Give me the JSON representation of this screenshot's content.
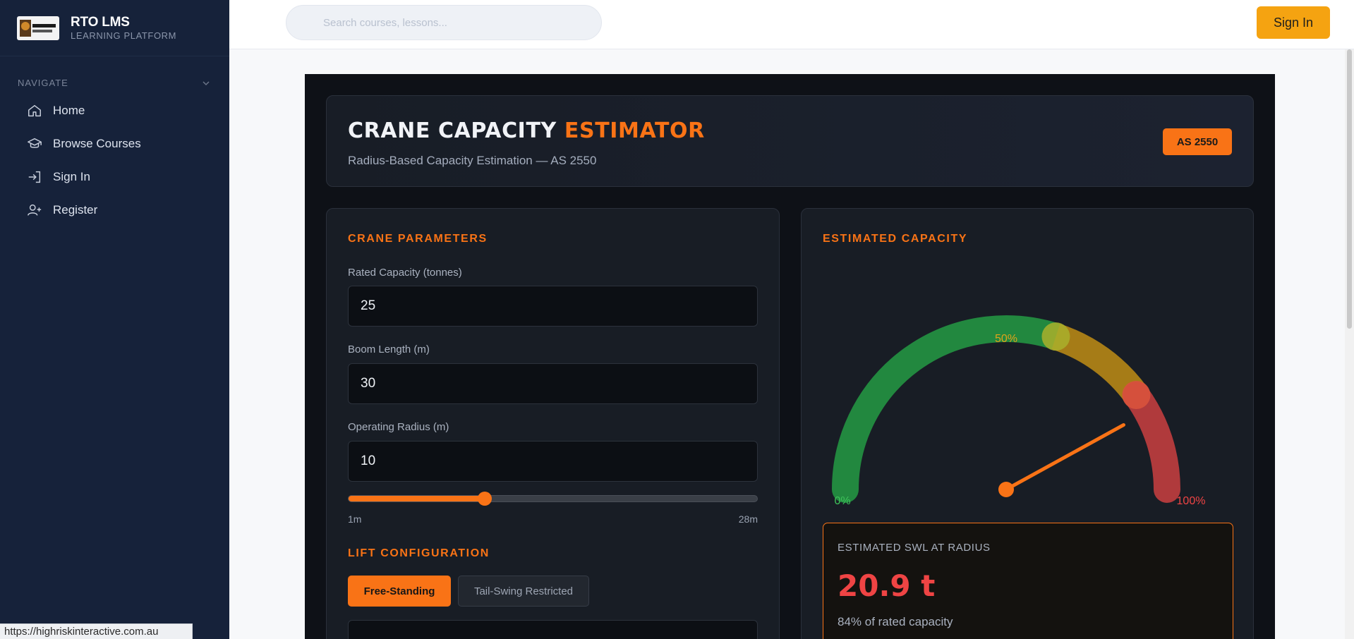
{
  "brand": {
    "title": "RTO LMS",
    "subtitle": "LEARNING PLATFORM",
    "logo_text": "HIGH RISK INTERACTIVE"
  },
  "sidebar": {
    "header": "NAVIGATE",
    "items": [
      {
        "label": "Home",
        "icon": "home-icon"
      },
      {
        "label": "Browse Courses",
        "icon": "graduation-cap-icon"
      },
      {
        "label": "Sign In",
        "icon": "sign-in-icon"
      },
      {
        "label": "Register",
        "icon": "user-plus-icon"
      }
    ]
  },
  "topbar": {
    "search_placeholder": "Search courses, lessons...",
    "signin_label": "Sign In"
  },
  "estimator": {
    "title_part1": "CRANE CAPACITY",
    "title_part2": "ESTIMATOR",
    "subtitle": "Radius-Based Capacity Estimation — AS 2550",
    "badge": "AS 2550",
    "accent_color": "#f97316"
  },
  "params": {
    "section_title": "CRANE PARAMETERS",
    "fields": [
      {
        "label": "Rated Capacity (tonnes)",
        "value": "25"
      },
      {
        "label": "Boom Length (m)",
        "value": "30"
      },
      {
        "label": "Operating Radius (m)",
        "value": "10"
      }
    ],
    "slider": {
      "min_label": "1m",
      "max_label": "28m",
      "min": 1,
      "max": 28,
      "value": 10
    },
    "config_title": "LIFT CONFIGURATION",
    "config_options": [
      "Free-Standing",
      "Tail-Swing Restricted"
    ],
    "config_selected": "Free-Standing"
  },
  "capacity": {
    "section_title": "ESTIMATED CAPACITY",
    "gauge": {
      "label_min": "0%",
      "label_mid": "50%",
      "label_max": "100%",
      "percent": 84,
      "zone_colors": [
        "#22883f",
        "#a67c17",
        "#b03a3c"
      ]
    },
    "swl_label": "ESTIMATED SWL AT RADIUS",
    "swl_value": "20.9 t",
    "swl_pct": "84% of rated capacity",
    "value_color": "#ef4444"
  },
  "status_url": "https://highriskinteractive.com.au"
}
